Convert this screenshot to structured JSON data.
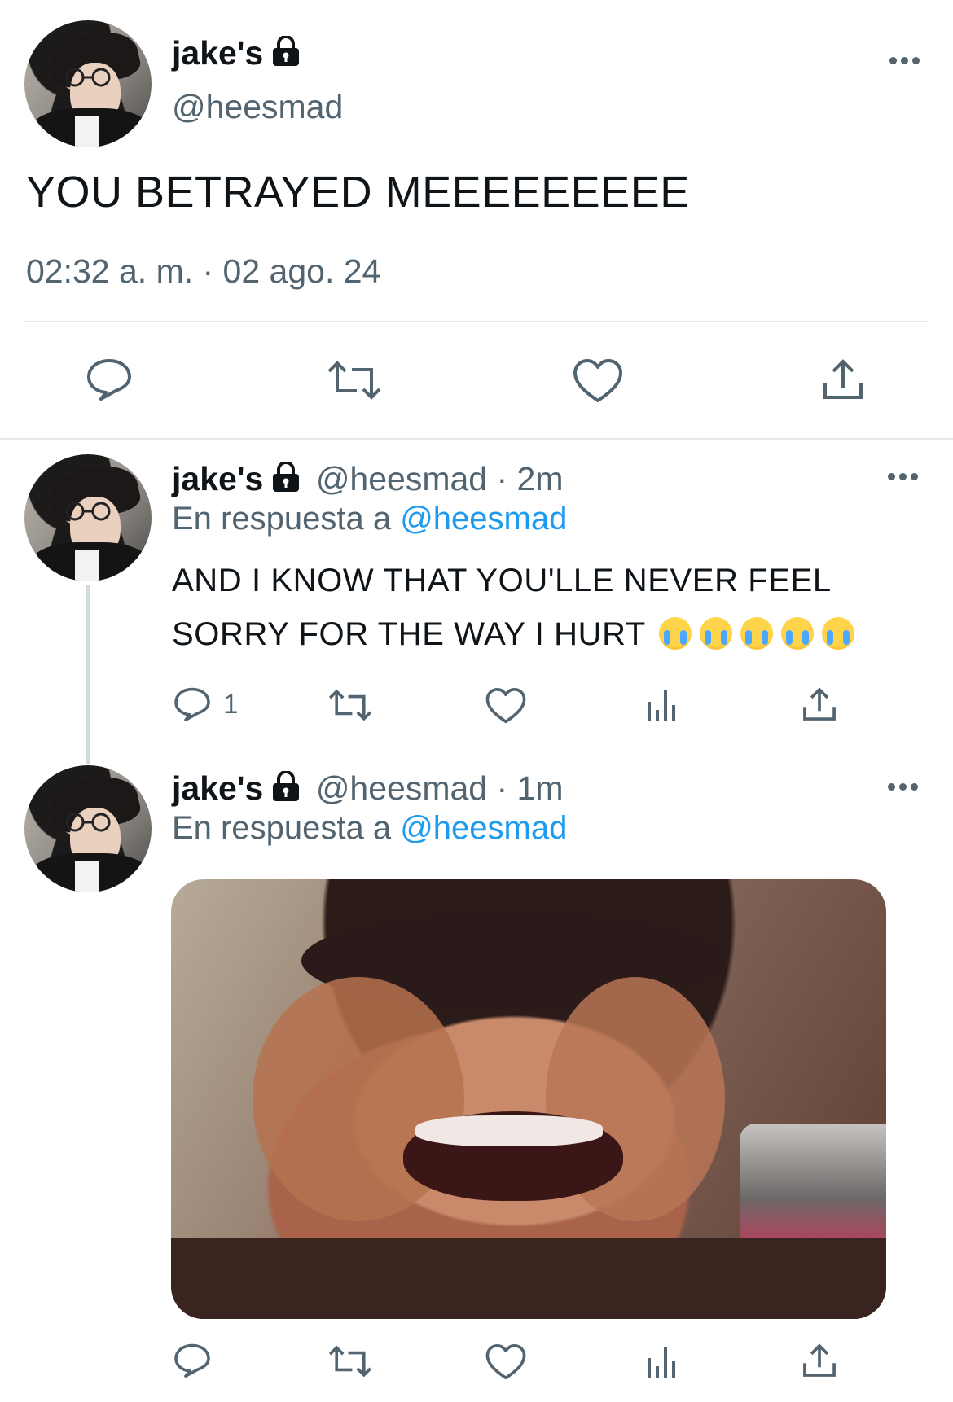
{
  "main_tweet": {
    "author_name": "jake's",
    "author_handle": "@heesmad",
    "text": "YOU BETRAYED MEEEEEEEEE",
    "timestamp": "02:32 a. m. · 02 ago. 24",
    "icons": [
      "reply-icon",
      "retweet-icon",
      "like-icon",
      "share-icon"
    ]
  },
  "reply_1": {
    "author_name": "jake's",
    "meta": "@heesmad · 2m",
    "reply_to_prefix": "En respuesta a",
    "reply_to_handle": "@heesmad",
    "text_line1": "AND I KNOW THAT YOU'LLE NEVER FEEL",
    "text_line2": "SORRY FOR THE WAY I HURT",
    "emoji_name": "loudly-crying-face",
    "reply_count": "1",
    "icons": [
      "reply-icon",
      "retweet-icon",
      "like-icon",
      "analytics-icon",
      "share-icon"
    ]
  },
  "reply_2": {
    "author_name": "jake's",
    "meta": "@heesmad · 1m",
    "reply_to_prefix": "En respuesta a",
    "reply_to_handle": "@heesmad",
    "media": "crying-face-photo",
    "icons": [
      "reply-icon",
      "retweet-icon",
      "like-icon",
      "analytics-icon",
      "share-icon"
    ]
  },
  "colors": {
    "text": "#0f1419",
    "secondary": "#536471",
    "link": "#1d9bf0",
    "divider": "#e6e9ec"
  }
}
